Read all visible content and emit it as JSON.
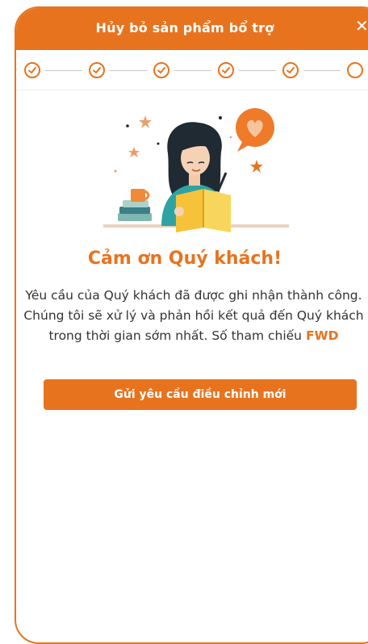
{
  "header": {
    "title": "Hủy bỏ sản phẩm bổ trợ",
    "close_label": "✕"
  },
  "stepper": {
    "completed_steps": 5,
    "total_steps": 6
  },
  "content": {
    "thanks_title": "Cảm ơn Quý khách!",
    "message": "Yêu cầu của Quý khách đã được ghi nhận thành công. Chúng tôi sẽ xử lý và phản hồi kết quả đến Quý khách trong thời gian sớm nhất. Số tham chiếu",
    "reference_number": "FWD"
  },
  "actions": {
    "new_request_label": "Gửi yêu cầu điều chỉnh mới"
  },
  "colors": {
    "brand": "#e8731f",
    "text": "#333333",
    "divider": "#c9c9c9"
  }
}
